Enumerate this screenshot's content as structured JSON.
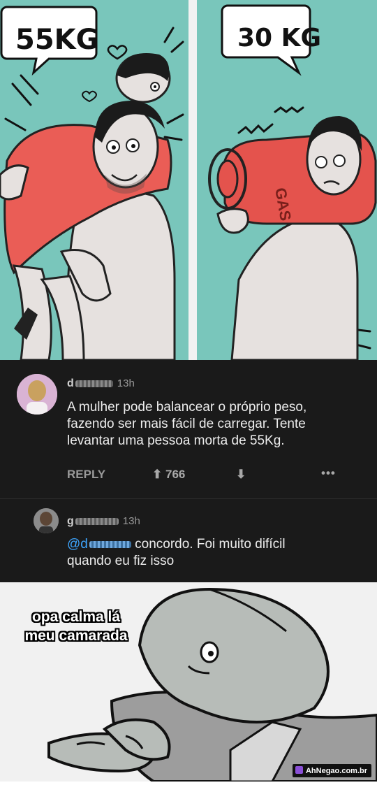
{
  "comic": {
    "left_bubble": "55KG",
    "right_bubble": "30 KG",
    "gas_label": "GAS"
  },
  "comments": [
    {
      "user_prefix": "d",
      "time": "13h",
      "text_lines": [
        "A mulher pode balancear o próprio peso,",
        "fazendo ser mais fácil de carregar. Tente",
        "levantar uma pessoa morta de 55Kg."
      ],
      "reply_label": "REPLY",
      "likes": "766"
    },
    {
      "user_prefix": "g",
      "time": "13h",
      "mention": "@d",
      "text_line1": "concordo. Foi muito difícil",
      "text_line2": "quando eu fiz isso"
    }
  ],
  "meme": {
    "caption_line1": "opa calma lá",
    "caption_line2": "meu camarada"
  },
  "watermark": "AhNegao.com.br",
  "colors": {
    "comic_bg": "#79c6bb",
    "dark_bg": "#1a1a1a",
    "mention": "#3ea6ff"
  }
}
